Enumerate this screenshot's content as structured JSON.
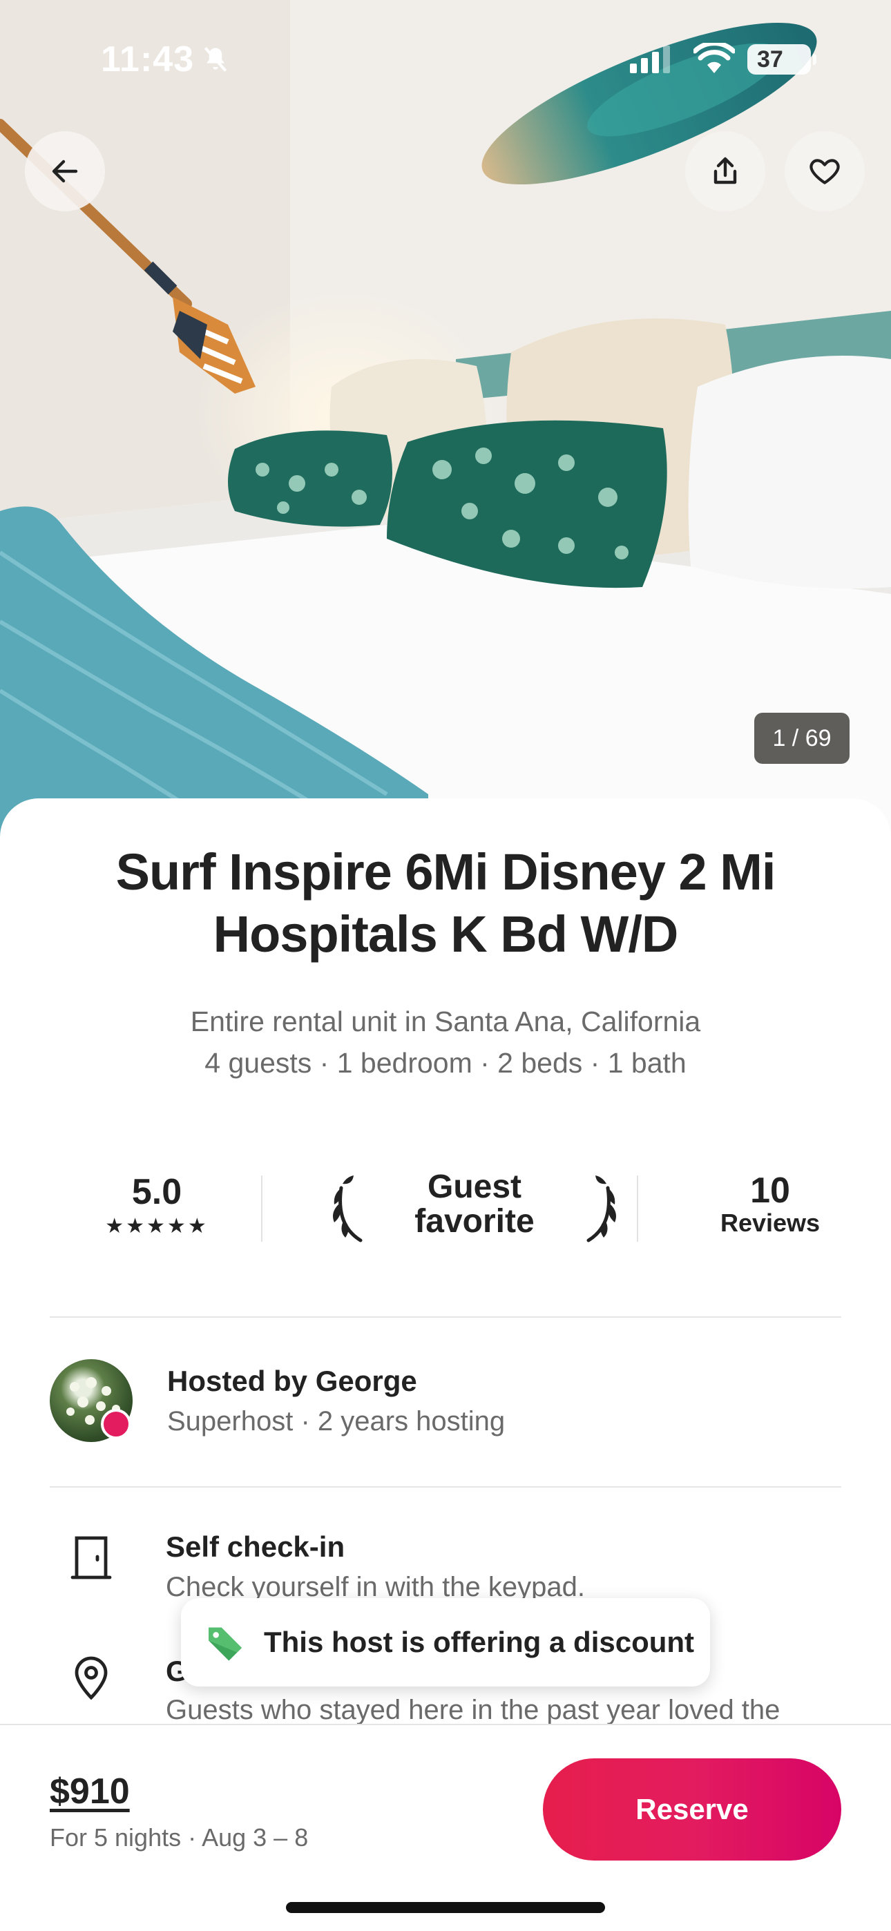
{
  "status_bar": {
    "time": "11:43",
    "battery": "37"
  },
  "gallery": {
    "counter": "1 / 69"
  },
  "listing": {
    "title": "Surf Inspire 6Mi Disney 2 Mi Hospitals K Bd W/D",
    "location_line": "Entire rental unit in Santa Ana, California",
    "details_line": "4 guests · 1 bedroom · 2 beds · 1 bath"
  },
  "stats": {
    "rating": "5.0",
    "stars": "★★★★★",
    "badge_line1": "Guest",
    "badge_line2": "favorite",
    "reviews_count": "10",
    "reviews_label": "Reviews"
  },
  "host": {
    "name": "Hosted by George",
    "meta": "Superhost · 2 years hosting"
  },
  "features": [
    {
      "icon": "door-icon",
      "title": "Self check-in",
      "desc": "Check yourself in with the keypad."
    },
    {
      "icon": "location-pin-icon",
      "title": "G",
      "desc": "Guests who stayed here in the past year loved the"
    }
  ],
  "toast": {
    "text": "This host is offering a discount",
    "icon": "price-tag-icon"
  },
  "footer": {
    "price": "$910",
    "dates": "For 5 nights · Aug 3 – 8",
    "reserve_label": "Reserve"
  },
  "colors": {
    "accent": "#e31c5f",
    "text": "#222222",
    "muted": "#6a6a6a"
  }
}
